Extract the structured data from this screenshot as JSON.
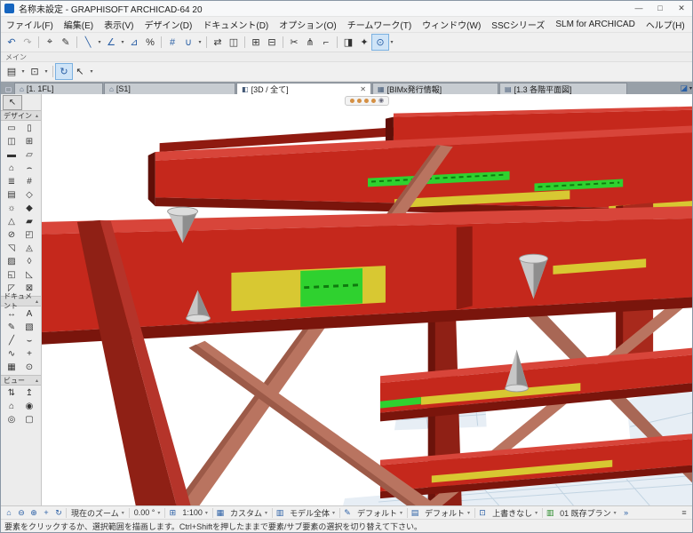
{
  "colors": {
    "structure_red": "#c5281c",
    "structure_bright_red": "#d8453a",
    "structure_dark_red": "#7a150c",
    "brace_salmon": "#b97460",
    "highlight_yellow": "#d8c832",
    "highlight_green": "#2fd12f",
    "floor_blue": "#e7eef5",
    "selection_blue": "#cfe4f7"
  },
  "window": {
    "title": "名称未設定 - GRAPHISOFT ARCHICAD-64 20",
    "controls": {
      "minimize": "—",
      "maximize": "□",
      "close": "✕"
    }
  },
  "menubar": {
    "items": [
      "ファイル(F)",
      "編集(E)",
      "表示(V)",
      "デザイン(D)",
      "ドキュメント(D)",
      "オプション(O)",
      "チームワーク(T)",
      "ウィンドウ(W)",
      "SSCシリーズ",
      "SLM for ARCHICAD",
      "ヘルプ(H)"
    ]
  },
  "toolbar1": {
    "items": [
      {
        "name": "undo-icon",
        "glyph": "↶",
        "type": "icon"
      },
      {
        "name": "redo-icon",
        "glyph": "↷",
        "type": "icon dim"
      },
      {
        "type": "sep"
      },
      {
        "name": "select-plus-icon",
        "glyph": "⌖",
        "type": "icon dark"
      },
      {
        "name": "pencil-icon",
        "glyph": "✎",
        "type": "icon dark"
      },
      {
        "type": "sep"
      },
      {
        "name": "line-tool-icon",
        "glyph": "╲",
        "type": "icon"
      },
      {
        "name": "line-caret",
        "glyph": "▾",
        "type": "caret"
      },
      {
        "name": "angle-tool-icon",
        "glyph": "∠",
        "type": "icon"
      },
      {
        "name": "angle-caret",
        "glyph": "▾",
        "type": "caret"
      },
      {
        "name": "offset-tool-icon",
        "glyph": "⊿",
        "type": "icon"
      },
      {
        "name": "percent-tool-icon",
        "glyph": "%",
        "type": "icon dark"
      },
      {
        "type": "sep"
      },
      {
        "name": "grid-snap-icon",
        "glyph": "#",
        "type": "icon"
      },
      {
        "name": "magnet-icon",
        "glyph": "∪",
        "type": "icon"
      },
      {
        "name": "magnet-caret",
        "glyph": "▾",
        "type": "caret"
      },
      {
        "type": "sep"
      },
      {
        "name": "transform-icon",
        "glyph": "⇄",
        "type": "icon dark"
      },
      {
        "name": "mirror-icon",
        "glyph": "◫",
        "type": "icon dark"
      },
      {
        "type": "sep"
      },
      {
        "name": "group-icon",
        "glyph": "⊞",
        "type": "icon dark"
      },
      {
        "name": "ungroup-icon",
        "glyph": "⊟",
        "type": "icon dark"
      },
      {
        "type": "sep"
      },
      {
        "name": "trim-icon",
        "glyph": "✂",
        "type": "icon dark"
      },
      {
        "name": "split-icon",
        "glyph": "⋔",
        "type": "icon dark"
      },
      {
        "name": "adjust-icon",
        "glyph": "⌐",
        "type": "icon dark"
      },
      {
        "type": "sep"
      },
      {
        "name": "compare-icon",
        "glyph": "◨",
        "type": "icon dark"
      },
      {
        "name": "markup-icon",
        "glyph": "✦",
        "type": "icon dark"
      },
      {
        "name": "view-options-icon",
        "glyph": "⊙",
        "type": "icon",
        "active": true
      },
      {
        "name": "view-options-caret",
        "glyph": "▾",
        "type": "caret"
      }
    ]
  },
  "main_toolbar": {
    "label": "メイン",
    "items": [
      {
        "name": "favorites-button",
        "glyph": "▤",
        "type": "icon dark"
      },
      {
        "name": "favorites-caret",
        "glyph": "▾",
        "type": "caret"
      },
      {
        "name": "default-settings-button",
        "glyph": "⊡",
        "type": "icon dark"
      },
      {
        "name": "settings-caret",
        "glyph": "▾",
        "type": "caret"
      },
      {
        "type": "sep"
      },
      {
        "name": "orbit-button",
        "glyph": "↻",
        "type": "icon",
        "active": true
      },
      {
        "name": "select-arrow-button",
        "glyph": "↖",
        "type": "icon dark"
      },
      {
        "name": "select-arrow-caret",
        "glyph": "▾",
        "type": "caret"
      }
    ]
  },
  "tabbar": {
    "leading_icon": "▢",
    "tabs": [
      {
        "icon": "⌂",
        "label": "[1. 1FL]"
      },
      {
        "icon": "⌂",
        "label": "[S1]"
      },
      {
        "icon": "◧",
        "label": "[3D / 全て]",
        "active": true,
        "close": "✕"
      },
      {
        "icon": "▦",
        "label": "[BIMx発行情報]"
      },
      {
        "icon": "▤",
        "label": "[1.3 各階平面図]"
      }
    ],
    "right_icon": "◪",
    "right_caret": "▾"
  },
  "toolbox": {
    "select_tool": {
      "name": "tool-select",
      "glyph": "↖"
    },
    "collapse_caret": "▴",
    "design_label": "デザイン",
    "design_tools": [
      {
        "name": "tool-wall",
        "glyph": "▭"
      },
      {
        "name": "tool-column",
        "glyph": "▯"
      },
      {
        "name": "tool-door",
        "glyph": "◫"
      },
      {
        "name": "tool-window",
        "glyph": "⊞"
      },
      {
        "name": "tool-beam",
        "glyph": "▬"
      },
      {
        "name": "tool-slab",
        "glyph": "▱"
      },
      {
        "name": "tool-roof",
        "glyph": "⌂"
      },
      {
        "name": "tool-shell",
        "glyph": "⌢"
      },
      {
        "name": "tool-stair",
        "glyph": "≣"
      },
      {
        "name": "tool-railing",
        "glyph": "#"
      },
      {
        "name": "tool-curtain-wall",
        "glyph": "▤"
      },
      {
        "name": "tool-object",
        "glyph": "◇"
      },
      {
        "name": "tool-lamp",
        "glyph": "☼"
      },
      {
        "name": "tool-morph",
        "glyph": "◆"
      },
      {
        "name": "tool-mesh",
        "glyph": "△"
      },
      {
        "name": "tool-zone",
        "glyph": "▰"
      },
      {
        "name": "tool-opening",
        "glyph": "⊘"
      },
      {
        "name": "tool-corner-window",
        "glyph": "◰"
      },
      {
        "name": "tool-skylight",
        "glyph": "◹"
      },
      {
        "name": "tool-truss",
        "glyph": "◬"
      },
      {
        "name": "tool-panel",
        "glyph": "▨"
      },
      {
        "name": "tool-profile",
        "glyph": "◊"
      },
      {
        "name": "tool-niche",
        "glyph": "◱"
      },
      {
        "name": "tool-ramp",
        "glyph": "◺"
      },
      {
        "name": "tool-canopy",
        "glyph": "◸"
      },
      {
        "name": "tool-extra",
        "glyph": "⊠"
      }
    ],
    "document_label": "ドキュメント",
    "document_tools": [
      {
        "name": "tool-dimension",
        "glyph": "↔"
      },
      {
        "name": "tool-text",
        "glyph": "A"
      },
      {
        "name": "tool-label",
        "glyph": "✎"
      },
      {
        "name": "tool-fill",
        "glyph": "▧"
      },
      {
        "name": "tool-line",
        "glyph": "╱"
      },
      {
        "name": "tool-arc",
        "glyph": "⌣"
      },
      {
        "name": "tool-spline",
        "glyph": "∿"
      },
      {
        "name": "tool-hotspot",
        "glyph": "+"
      },
      {
        "name": "tool-figure",
        "glyph": "▦"
      },
      {
        "name": "tool-drawing",
        "glyph": "⊙"
      }
    ],
    "view_label": "ビュー",
    "view_tools": [
      {
        "name": "tool-section",
        "glyph": "⇅"
      },
      {
        "name": "tool-elevation",
        "glyph": "↥"
      },
      {
        "name": "tool-interior-elevation",
        "glyph": "⌂"
      },
      {
        "name": "tool-camera",
        "glyph": "◉"
      },
      {
        "name": "tool-detail",
        "glyph": "◎"
      },
      {
        "name": "tool-worksheet",
        "glyph": "▢"
      }
    ]
  },
  "viewport": {
    "palette_eye": "◉"
  },
  "statusbar": {
    "items": [
      {
        "name": "zoom-fit-icon",
        "glyph": "⌂",
        "type": "icon"
      },
      {
        "name": "zoom-out-icon",
        "glyph": "⊖",
        "type": "icon"
      },
      {
        "name": "zoom-in-icon",
        "glyph": "⊕",
        "type": "icon"
      },
      {
        "name": "pan-icon",
        "glyph": "+",
        "type": "icon"
      },
      {
        "name": "orbit-icon",
        "glyph": "↻",
        "type": "icon"
      },
      {
        "type": "sep"
      },
      {
        "name": "current-zoom-combo",
        "label": "現在のズーム",
        "type": "combo"
      },
      {
        "type": "sep"
      },
      {
        "name": "rotation-angle-field",
        "label": "0.00 °",
        "type": "combo"
      },
      {
        "type": "sep"
      },
      {
        "name": "pages-icon",
        "glyph": "⊞",
        "type": "icon"
      },
      {
        "name": "scale-combo",
        "label": "1:100",
        "type": "combo"
      },
      {
        "type": "sep"
      },
      {
        "name": "grid-icon",
        "glyph": "▦",
        "type": "icon"
      },
      {
        "name": "custom-combo",
        "label": "カスタム",
        "type": "combo"
      },
      {
        "type": "sep"
      },
      {
        "name": "filter-icon",
        "glyph": "▥",
        "type": "icon"
      },
      {
        "name": "model-scope-combo",
        "label": "モデル全体",
        "type": "combo"
      },
      {
        "type": "sep"
      },
      {
        "name": "pen-icon",
        "glyph": "✎",
        "type": "icon"
      },
      {
        "name": "pen-set-combo",
        "label": "デフォルト",
        "type": "combo"
      },
      {
        "type": "sep"
      },
      {
        "name": "layer-icon",
        "glyph": "▤",
        "type": "icon"
      },
      {
        "name": "layer-combo",
        "label": "デフォルト",
        "type": "combo"
      },
      {
        "type": "sep"
      },
      {
        "name": "override-icon",
        "glyph": "⊡",
        "type": "icon"
      },
      {
        "name": "override-combo",
        "label": "上書きなし",
        "type": "combo"
      },
      {
        "type": "sep"
      },
      {
        "name": "renovation-icon",
        "glyph": "▥",
        "type": "icon green"
      },
      {
        "name": "renovation-combo",
        "label": "01 既存プラン",
        "type": "combo"
      },
      {
        "name": "overflow-icon",
        "glyph": "»",
        "type": "icon"
      },
      {
        "name": "tray-icon",
        "glyph": "≡",
        "type": "icon right"
      }
    ]
  },
  "helpbar": {
    "text": "要素をクリックするか、選択範囲を描画します。Ctrl+Shiftを押したままで要素/サブ要素の選択を切り替えて下さい。"
  }
}
